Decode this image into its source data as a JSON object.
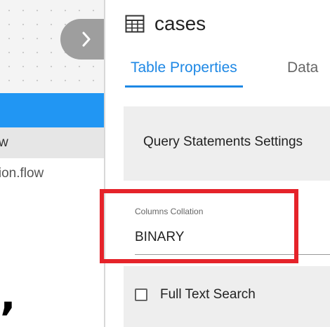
{
  "app": {
    "accent_color": "#1e88e5",
    "selection_color": "#2196f3",
    "highlight_color": "#e5232a"
  },
  "left_panel": {
    "collapse_icon": "chevron-right-icon",
    "files": [
      {
        "label": "w"
      },
      {
        "label": "ation.flow"
      }
    ],
    "stray_mark": ","
  },
  "table_panel": {
    "icon": "table-icon",
    "title": "cases",
    "tabs": [
      {
        "label": "Table Properties",
        "active": true
      },
      {
        "label": "Data",
        "active": false
      }
    ],
    "section_title": "Query Statements Settings",
    "columns_collation": {
      "label": "Columns Collation",
      "value": "BINARY"
    },
    "full_text_search": {
      "label": "Full Text Search",
      "checked": false
    }
  }
}
